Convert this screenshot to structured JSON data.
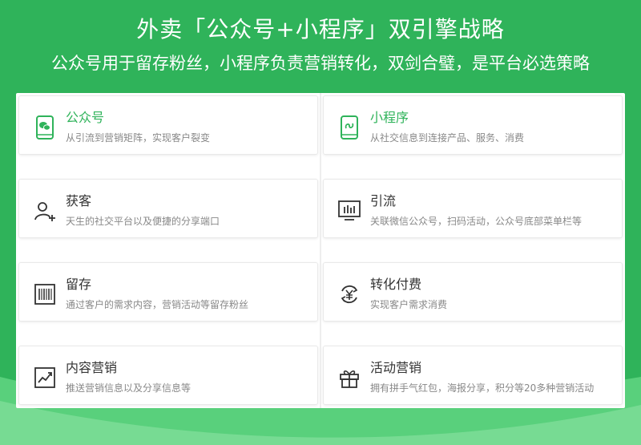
{
  "header": {
    "title": "外卖「公众号+小程序」双引擎战略",
    "subtitle": "公众号用于留存粉丝，小程序负责营销转化，双剑合璧，是平台必选策略"
  },
  "colors": {
    "brand_green": "#2fb35a",
    "light_green": "#59d07c",
    "highlight_text": "#2fb35a",
    "desc_text": "#888888"
  },
  "cards": {
    "left": [
      {
        "name": "公众号",
        "desc": "从引流到营销矩阵，实现客户裂变",
        "icon": "wechat-phone-icon"
      },
      {
        "name": "获客",
        "desc": "天生的社交平台以及便捷的分享端口",
        "icon": "add-user-icon"
      },
      {
        "name": "留存",
        "desc": "通过客户的需求内容，营销活动等留存粉丝",
        "icon": "barcode-box-icon"
      },
      {
        "name": "内容营销",
        "desc": "推送营销信息以及分享信息等",
        "icon": "growth-chart-icon"
      }
    ],
    "right": [
      {
        "name": "小程序",
        "desc": "从社交信息到连接产品、服务、消费",
        "icon": "mini-program-phone-icon"
      },
      {
        "name": "引流",
        "desc": "关联微信公众号，扫码活动，公众号底部菜单栏等",
        "icon": "monitor-bars-icon"
      },
      {
        "name": "转化付费",
        "desc": "实现客户需求消费",
        "icon": "yen-cycle-icon"
      },
      {
        "name": "活动营销",
        "desc": "拥有拼手气红包，海报分享，积分等20多种营销活动",
        "icon": "gift-icon"
      }
    ]
  }
}
